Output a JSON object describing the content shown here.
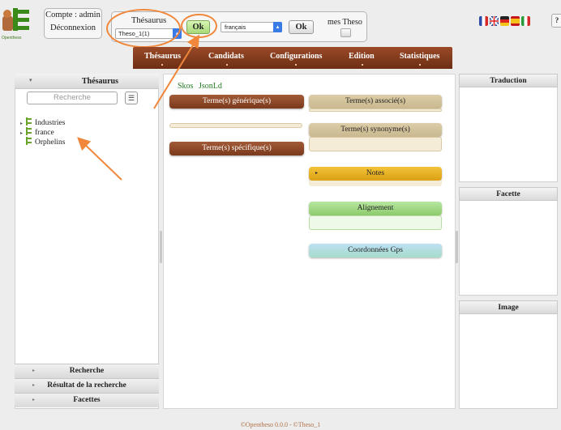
{
  "header": {
    "logo_label": "Opentheso",
    "account_label": "Compte : admin",
    "logout_label": "Déconnexion",
    "thesaurus_label": "Thésaurus",
    "thesaurus_select_value": "Theso_1(1)",
    "ok_label": "Ok",
    "language_select_value": "français",
    "ok2_label": "Ok",
    "my_theso_label": "mes Theso",
    "help_label": "?"
  },
  "flags": [
    "fr-flag-icon",
    "uk-flag-icon",
    "de-flag-icon",
    "es-flag-icon",
    "it-flag-icon"
  ],
  "nav": {
    "items": [
      "Thésaurus",
      "Candidats",
      "Configurations",
      "Edition",
      "Statistiques"
    ]
  },
  "left_panel": {
    "title": "Thésaurus",
    "search_placeholder": "Recherche",
    "tree": [
      {
        "label": "Industries",
        "expandable": true
      },
      {
        "label": "france",
        "expandable": true
      },
      {
        "label": "Orphelins",
        "expandable": false
      }
    ],
    "accordions": [
      "Recherche",
      "Résultat de la recherche",
      "Facettes"
    ]
  },
  "center": {
    "tabs": [
      "Skos",
      "JsonLd"
    ],
    "generic_terms_label": "Terme(s) générique(s)",
    "specific_terms_label": "Terme(s) spécifique(s)",
    "associated_terms_label": "Terme(s) associé(s)",
    "synonym_terms_label": "Terme(s) synonyme(s)",
    "notes_label": "Notes",
    "alignment_label": "Alignement",
    "gps_label": "Coordonnées Gps"
  },
  "right_panel": {
    "translation_title": "Traduction",
    "facet_title": "Facette",
    "image_title": "Image"
  },
  "footer": {
    "text": "©Opentheso 0.0.0 - ©Theso_1"
  },
  "colors": {
    "nav_brown": "#7a3a1c",
    "annotation_orange": "#f0873a",
    "tree_green": "#6aa42a",
    "link_green": "#237a23"
  }
}
